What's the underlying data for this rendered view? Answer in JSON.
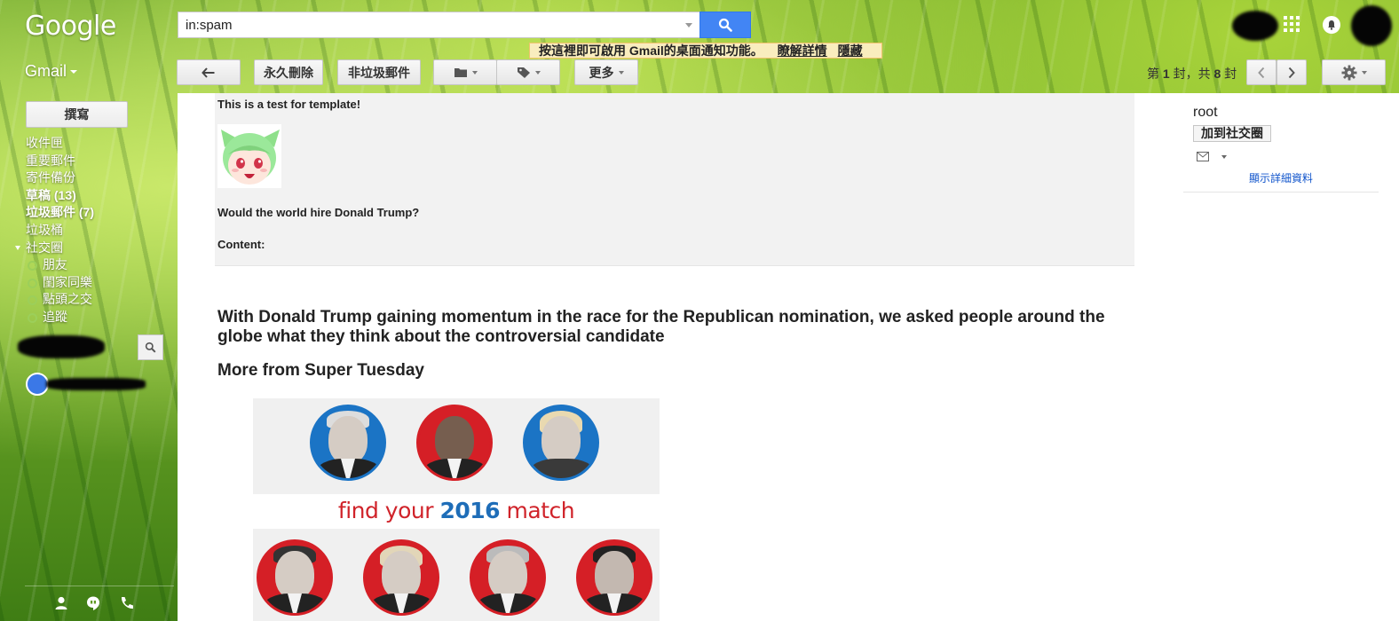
{
  "header": {
    "logo": "Google",
    "search_value": "in:spam",
    "notification": {
      "text": "按這裡即可啟用 Gmail的桌面通知功能。",
      "learn_more": "瞭解詳情",
      "hide": "隱藏"
    }
  },
  "toolbar": {
    "app_switch": "Gmail",
    "delete_forever": "永久刪除",
    "not_spam": "非垃圾郵件",
    "more": "更多",
    "pager": {
      "prefix": "第",
      "current": "1",
      "middle": "封，共",
      "total": "8",
      "suffix": "封"
    }
  },
  "sidebar": {
    "compose": "撰寫",
    "items": [
      {
        "label": "收件匣",
        "count": ""
      },
      {
        "label": "重要郵件",
        "count": ""
      },
      {
        "label": "寄件備份",
        "count": ""
      },
      {
        "label": "草稿",
        "count": "(13)"
      },
      {
        "label": "垃圾郵件",
        "count": "(7)"
      },
      {
        "label": "垃圾桶",
        "count": ""
      },
      {
        "label": "社交圈",
        "count": ""
      }
    ],
    "circles": [
      {
        "label": "朋友"
      },
      {
        "label": "閨家同樂"
      },
      {
        "label": "點頭之交"
      },
      {
        "label": "追蹤"
      }
    ]
  },
  "message": {
    "intro": "This is a test for template!",
    "question": "Would the world hire Donald Trump?",
    "content_label": "Content:",
    "headline": "With Donald Trump gaining momentum in the race for the Republican nomination, we asked people around the globe what they think about the controversial candidate",
    "subhead": "More from Super Tuesday",
    "promo": {
      "text_before": "find your",
      "year": "2016",
      "text_after": "match"
    }
  },
  "contact": {
    "name": "root",
    "add_to_circles": "加到社交圈",
    "show_details": "顯示詳細資料"
  },
  "colors": {
    "search_button": "#4285f4",
    "notify_bg": "#f9edbe",
    "democrat_blue": "#1b74c5",
    "republican_red": "#d51f26",
    "link": "#1155cc"
  }
}
